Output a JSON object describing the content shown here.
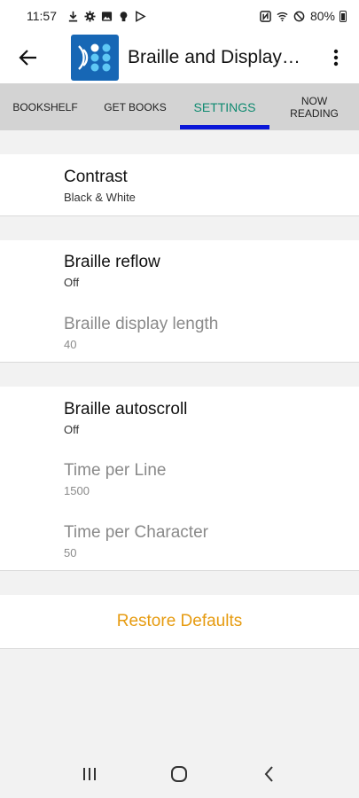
{
  "status_bar": {
    "time": "11:57",
    "battery": "80%",
    "left_icons": [
      "download-icon",
      "settings-icon",
      "image-icon",
      "bulb-icon",
      "play-store-icon"
    ],
    "right_icons": [
      "nfc-icon",
      "wifi-icon",
      "do-not-disturb-icon",
      "battery-icon"
    ]
  },
  "app_bar": {
    "title": "Braille and Display Settings"
  },
  "tabs": [
    {
      "label": "BOOKSHELF",
      "active": false
    },
    {
      "label": "GET BOOKS",
      "active": false
    },
    {
      "label": "SETTINGS",
      "active": true
    },
    {
      "label": "NOW READING",
      "active": false
    }
  ],
  "prefs": {
    "contrast": {
      "title": "Contrast",
      "summary": "Black & White"
    },
    "reflow": {
      "title": "Braille reflow",
      "summary": "Off"
    },
    "display_length": {
      "title": "Braille display length",
      "summary": "40"
    },
    "autoscroll": {
      "title": "Braille autoscroll",
      "summary": "Off"
    },
    "time_per_line": {
      "title": "Time per Line",
      "summary": "1500"
    },
    "time_per_char": {
      "title": "Time per Character",
      "summary": "50"
    }
  },
  "restore": {
    "label": "Restore Defaults"
  },
  "colors": {
    "accent": "#e69b10",
    "tab_active_text": "#0f8a70",
    "tab_indicator": "#0a17d8",
    "logo_bg": "#1767b5"
  }
}
